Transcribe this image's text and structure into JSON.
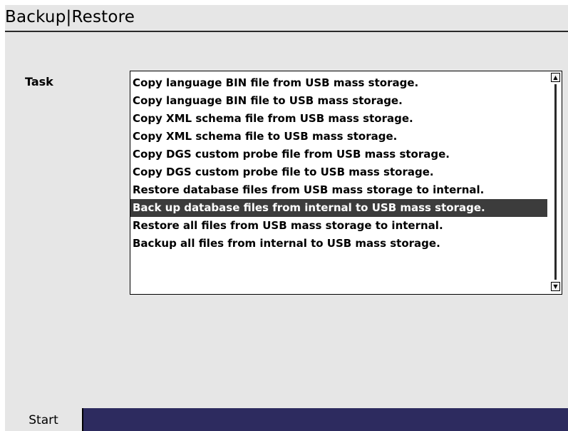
{
  "header": {
    "title": "Backup|Restore"
  },
  "task": {
    "label": "Task",
    "selected_index": 7,
    "items": [
      "Copy language BIN file from USB mass storage.",
      "Copy language BIN file to USB mass storage.",
      "Copy XML schema file from USB mass storage.",
      "Copy XML schema file to USB mass storage.",
      "Copy DGS custom probe file from USB mass storage.",
      "Copy DGS custom probe file to USB mass storage.",
      "Restore database files from USB mass storage to internal.",
      "Back up database files from internal to USB mass storage.",
      "Restore all files from USB mass storage to internal.",
      "Backup all files from internal to USB mass storage."
    ]
  },
  "footer": {
    "start_label": "Start"
  },
  "icons": {
    "scroll_up": "scroll-up-icon",
    "scroll_down": "scroll-down-icon"
  },
  "colors": {
    "background": "#e6e6e6",
    "selection": "#3c3c3c",
    "bottom_bar": "#2d2b5f"
  }
}
